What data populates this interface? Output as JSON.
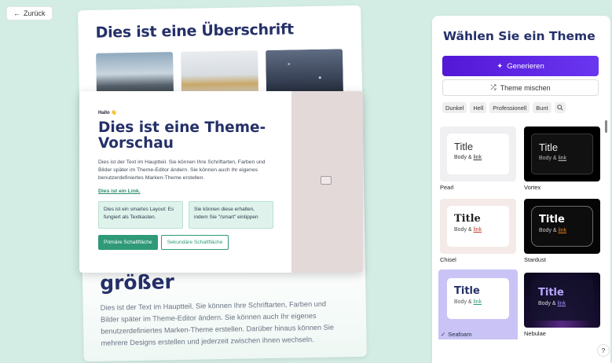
{
  "back_label": "Zurück",
  "background_card": {
    "title": "Dies ist eine Überschrift",
    "big_heading": "größer",
    "body": "Dies ist der Text im Hauptteil. Sie können Ihre Schriftarten, Farben und Bilder später im Theme-Editor ändern. Sie können auch Ihr eigenes benutzerdefiniertes Marken-Theme erstellen. Darüber hinaus können Sie mehrere Designs erstellen und jederzeit zwischen ihnen wechseln."
  },
  "preview": {
    "greeting": "Hallo 👋",
    "title": "Dies ist eine Theme-Vorschau",
    "text": "Dies ist der Text im Hauptteil. Sie können Ihre Schriftarten, Farben und Bilder später im Theme-Editor ändern. Sie können auch Ihr eigenes benutzerdefiniertes Marken-Theme erstellen.",
    "link": "Dies ist ein Link.",
    "box1": "Dies ist ein smartes Layout: Es fungiert als Textkasten.",
    "box2": "Sie können diese erhalten, indem Sie \"/smart\" eintippen",
    "primary_button": "Primäre Schaltfläche",
    "secondary_button": "Sekundäre Schaltfläche"
  },
  "panel": {
    "title": "Wählen Sie ein Theme",
    "generate_label": "Generieren",
    "mix_label": "Theme mischen",
    "filters": [
      "Dunkel",
      "Hell",
      "Professionell",
      "Bunt"
    ]
  },
  "themes": [
    {
      "name": "Pearl",
      "title": "Title",
      "body": "Body &",
      "link": "link"
    },
    {
      "name": "Vortex",
      "title": "Title",
      "body": "Body &",
      "link": "link"
    },
    {
      "name": "Chisel",
      "title": "Title",
      "body": "Body &",
      "link": "link"
    },
    {
      "name": "Stardust",
      "title": "Title",
      "body": "Body &",
      "link": "link"
    },
    {
      "name": "Seafoam",
      "title": "Title",
      "body": "Body &",
      "link": "link",
      "selected": true
    },
    {
      "name": "Nebulae",
      "title": "Title",
      "body": "Body &",
      "link": "link"
    }
  ],
  "help_label": "?",
  "colors": {
    "accent": "#5a22e6",
    "brand_green": "#2f9978",
    "heading": "#253069"
  }
}
